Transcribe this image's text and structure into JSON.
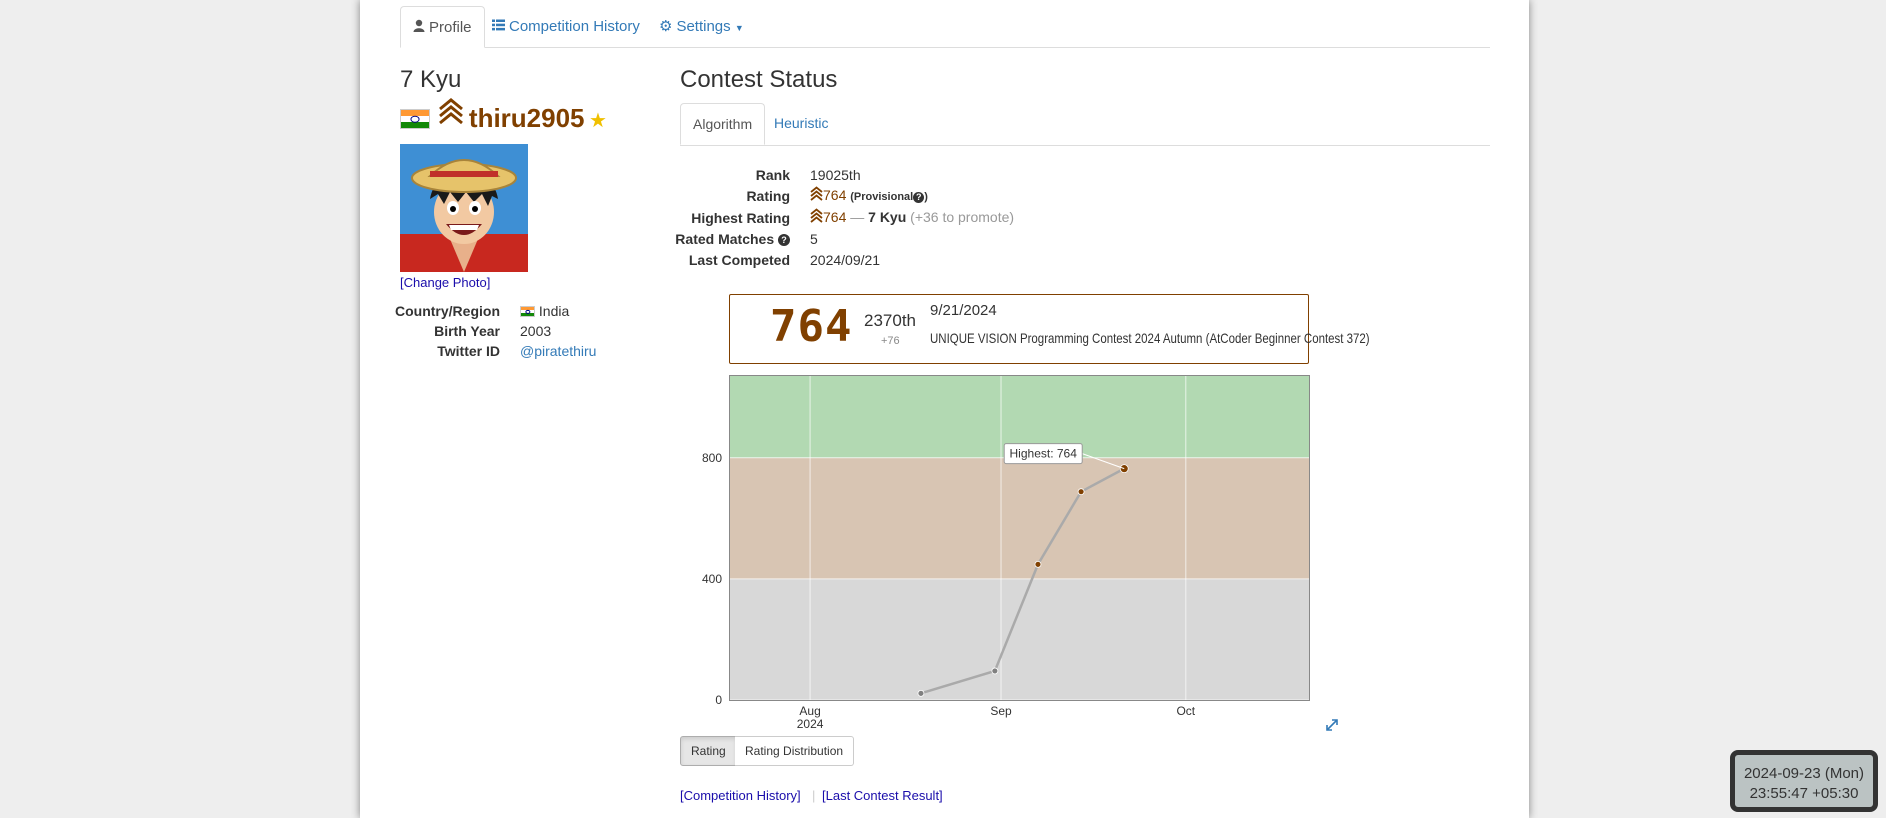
{
  "nav": {
    "tabs": [
      {
        "label": "Profile",
        "icon": "user-icon",
        "active": true
      },
      {
        "label": "Competition History",
        "icon": "list-icon",
        "active": false
      },
      {
        "label": "Settings",
        "icon": "gear-icon",
        "active": false
      }
    ]
  },
  "profile": {
    "rank_title": "7 Kyu",
    "username": "thiru2905",
    "change_photo": "[Change Photo]",
    "info": [
      {
        "label": "Country/Region",
        "value": "India"
      },
      {
        "label": "Birth Year",
        "value": "2003"
      },
      {
        "label": "Twitter ID",
        "value": "@piratethiru"
      }
    ]
  },
  "contest": {
    "heading": "Contest Status",
    "tabs": [
      {
        "label": "Algorithm",
        "active": true
      },
      {
        "label": "Heuristic",
        "active": false
      }
    ],
    "stats": {
      "rank_label": "Rank",
      "rank_value": "19025th",
      "rating_label": "Rating",
      "rating_value": "764",
      "provisional": "(Provisional",
      "highest_label": "Highest Rating",
      "highest_value": "764",
      "highest_sep": "—",
      "highest_kyu": "7 Kyu",
      "highest_promote": "(+36 to promote)",
      "matches_label": "Rated Matches",
      "matches_value": "5",
      "last_label": "Last Competed",
      "last_value": "2024/09/21"
    },
    "card": {
      "rating": "764",
      "place": "2370th",
      "diff": "+76",
      "date": "9/21/2024",
      "contest_name": "UNIQUE VISION Programming Contest 2024 Autumn (AtCoder Beginner Contest 372)"
    },
    "buttons": [
      {
        "label": "Rating",
        "active": true
      },
      {
        "label": "Rating Distribution",
        "active": false
      }
    ],
    "links": {
      "history": "[Competition History]",
      "last_result": "[Last Contest Result]"
    }
  },
  "chart_data": {
    "type": "line",
    "series": [
      {
        "x": [
          "2024-08-19",
          "2024-08-31",
          "2024-09-07",
          "2024-09-14",
          "2024-09-21"
        ],
        "y": [
          22,
          96,
          448,
          688,
          764
        ]
      }
    ],
    "y_ticks": [
      0,
      400,
      800
    ],
    "x_ticks": [
      {
        "label": "Aug",
        "sub": "2024",
        "date": "2024-08-01"
      },
      {
        "label": "Sep",
        "date": "2024-09-01"
      },
      {
        "label": "Oct",
        "date": "2024-10-01"
      }
    ],
    "ylim": [
      0,
      1070
    ],
    "xlim": [
      "2024-07-19",
      "2024-10-21"
    ],
    "bands": [
      {
        "from": 0,
        "to": 400,
        "color": "#d8d8d8"
      },
      {
        "from": 400,
        "to": 800,
        "color": "#d8c5b3"
      },
      {
        "from": 800,
        "to": 1070,
        "color": "#b2d9b2"
      }
    ],
    "annotation": "Highest: 764",
    "grid": true
  },
  "clock": {
    "date": "2024-09-23 (Mon)",
    "time": "23:55:47 +05:30"
  },
  "colors": {
    "rating_brown": "#804000",
    "link_blue": "#337ab7",
    "link_navy": "#1a0dab"
  }
}
